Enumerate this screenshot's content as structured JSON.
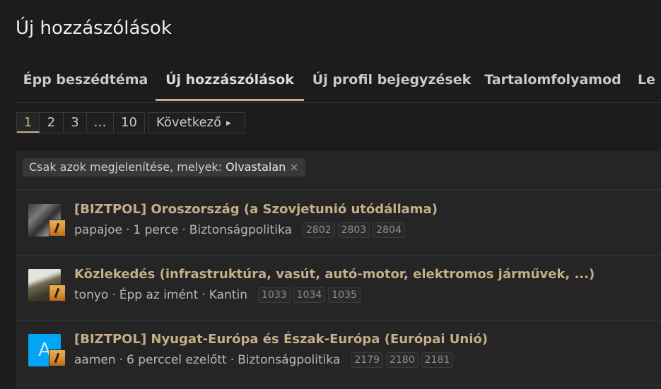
{
  "page": {
    "title": "Új hozzászólások"
  },
  "tabs": [
    {
      "label": "Épp beszédtéma",
      "active": false
    },
    {
      "label": "Új hozzászólások",
      "active": true
    },
    {
      "label": "Új profil bejegyzések",
      "active": false
    },
    {
      "label": "Tartalomfolyamod",
      "active": false
    },
    {
      "label": "Le",
      "active": false
    }
  ],
  "pagination": {
    "pages": [
      "1",
      "2",
      "3",
      "…",
      "10"
    ],
    "current": "1",
    "next_label": "Következő"
  },
  "filter": {
    "label": "Csak azok megjelenítése, melyek:",
    "value": "Olvastalan",
    "remove": "×"
  },
  "threads": [
    {
      "title": "[BIZTPOL] Oroszország (a Szovjetunió utódállama)",
      "author": "papajoe",
      "time": "1 perce",
      "forum": "Biztonságpolitika",
      "pages": [
        "2802",
        "2803",
        "2804"
      ],
      "avatar": "photo-avatar"
    },
    {
      "title": "Közlekedés (infrastruktúra, vasút, autó-motor, elektromos járművek, ...)",
      "author": "tonyo",
      "time": "Épp az imént",
      "forum": "Kantin",
      "pages": [
        "1033",
        "1034",
        "1035"
      ],
      "avatar": "photo-avatar"
    },
    {
      "title": "[BIZTPOL] Nyugat-Európa és Észak-Európa (Európai Unió)",
      "author": "aamen",
      "time": "6 perccel ezelőtt",
      "forum": "Biztonságpolitika",
      "pages": [
        "2179",
        "2180",
        "2181"
      ],
      "avatar": "letter-avatar",
      "avatar_letter": "A",
      "avatar_color": "#00a6f5"
    }
  ],
  "colors": {
    "background": "#1c1c1c",
    "panel": "#252525",
    "accent": "#c7ad89"
  }
}
